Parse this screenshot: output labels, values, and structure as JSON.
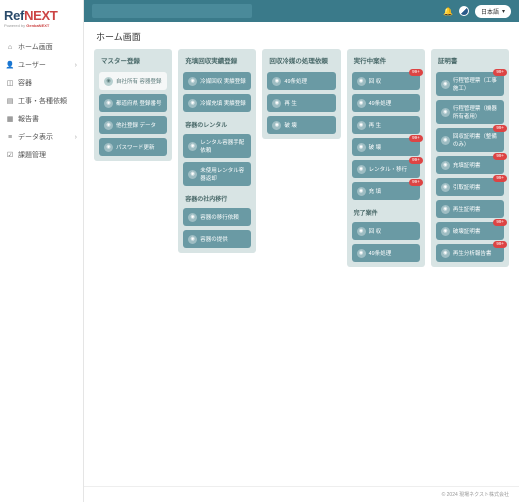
{
  "brand": {
    "part1": "Ref",
    "part2": "NEXT",
    "powered_prefix": "Powered by ",
    "powered_brand": "GenbaNEXT"
  },
  "topbar": {
    "lang": "日本語"
  },
  "page_title": "ホーム画面",
  "sidebar": {
    "items": [
      {
        "label": "ホーム画面",
        "icon": "home",
        "exp": false
      },
      {
        "label": "ユーザー",
        "icon": "user",
        "exp": true
      },
      {
        "label": "容器",
        "icon": "cylinder",
        "exp": false
      },
      {
        "label": "工事・各種依頼",
        "icon": "doc",
        "exp": false
      },
      {
        "label": "報告書",
        "icon": "report",
        "exp": false
      },
      {
        "label": "データ表示",
        "icon": "data",
        "exp": true
      },
      {
        "label": "課題管理",
        "icon": "task",
        "exp": false
      }
    ]
  },
  "columns": [
    {
      "header": "マスター登録",
      "groups": [
        {
          "items": [
            {
              "label": "自社所有 容器登録",
              "light": true,
              "icon": "cyl"
            },
            {
              "label": "都道府県 登録番号",
              "icon": "map"
            },
            {
              "label": "他社登録 データ",
              "icon": "cyl"
            },
            {
              "label": "パスワード更新",
              "icon": "key"
            }
          ]
        }
      ]
    },
    {
      "header": "充填回収実績登録",
      "groups": [
        {
          "items": [
            {
              "label": "冷媒回収 実績登録",
              "icon": "rec"
            },
            {
              "label": "冷媒充填 実績登録",
              "icon": "fill"
            }
          ]
        },
        {
          "sub": "容器のレンタル",
          "items": [
            {
              "label": "レンタル容器手配依頼",
              "icon": "cyl"
            },
            {
              "label": "未使用レンタル容器返却",
              "icon": "ret"
            }
          ]
        },
        {
          "sub": "容器の社内移行",
          "items": [
            {
              "label": "容器の移行依頼",
              "icon": "mv"
            },
            {
              "label": "容器の提供",
              "icon": "give"
            }
          ]
        }
      ]
    },
    {
      "header": "回収冷媒の処理依頼",
      "groups": [
        {
          "items": [
            {
              "label": "49条処理",
              "icon": "proc"
            },
            {
              "label": "再 生",
              "icon": "recy"
            },
            {
              "label": "破 壊",
              "icon": "dest"
            }
          ]
        }
      ]
    },
    {
      "header": "実行中案件",
      "groups": [
        {
          "items": [
            {
              "label": "回 収",
              "icon": "rec",
              "badge": "99+"
            },
            {
              "label": "49条処理",
              "icon": "proc"
            },
            {
              "label": "再 生",
              "icon": "recy"
            },
            {
              "label": "破 壊",
              "icon": "dest",
              "badge": "99+"
            },
            {
              "label": "レンタル・移行",
              "icon": "mv",
              "badge": "99+"
            },
            {
              "label": "充 填",
              "icon": "fill",
              "badge": "99+"
            }
          ]
        },
        {
          "sub": "完了案件",
          "items": [
            {
              "label": "回 収",
              "icon": "rec"
            },
            {
              "label": "49条処理",
              "icon": "proc"
            }
          ]
        }
      ]
    },
    {
      "header": "証明書",
      "groups": [
        {
          "items": [
            {
              "label": "行程管理票（工事施工）",
              "icon": "doc",
              "badge": "99+"
            },
            {
              "label": "行程管理票（機器所有者用）",
              "icon": "doc"
            },
            {
              "label": "回収証明書（整備のみ）",
              "icon": "doc",
              "badge": "99+"
            },
            {
              "label": "充填証明書",
              "icon": "doc",
              "badge": "99+"
            },
            {
              "label": "引取証明書",
              "icon": "doc",
              "badge": "99+"
            },
            {
              "label": "再生証明書",
              "icon": "doc"
            },
            {
              "label": "破壊証明書",
              "icon": "doc",
              "badge": "99+"
            },
            {
              "label": "再生分析報告書",
              "icon": "doc",
              "badge": "99+"
            }
          ]
        }
      ]
    }
  ],
  "footer": "© 2024 現場ネクスト株式会社"
}
